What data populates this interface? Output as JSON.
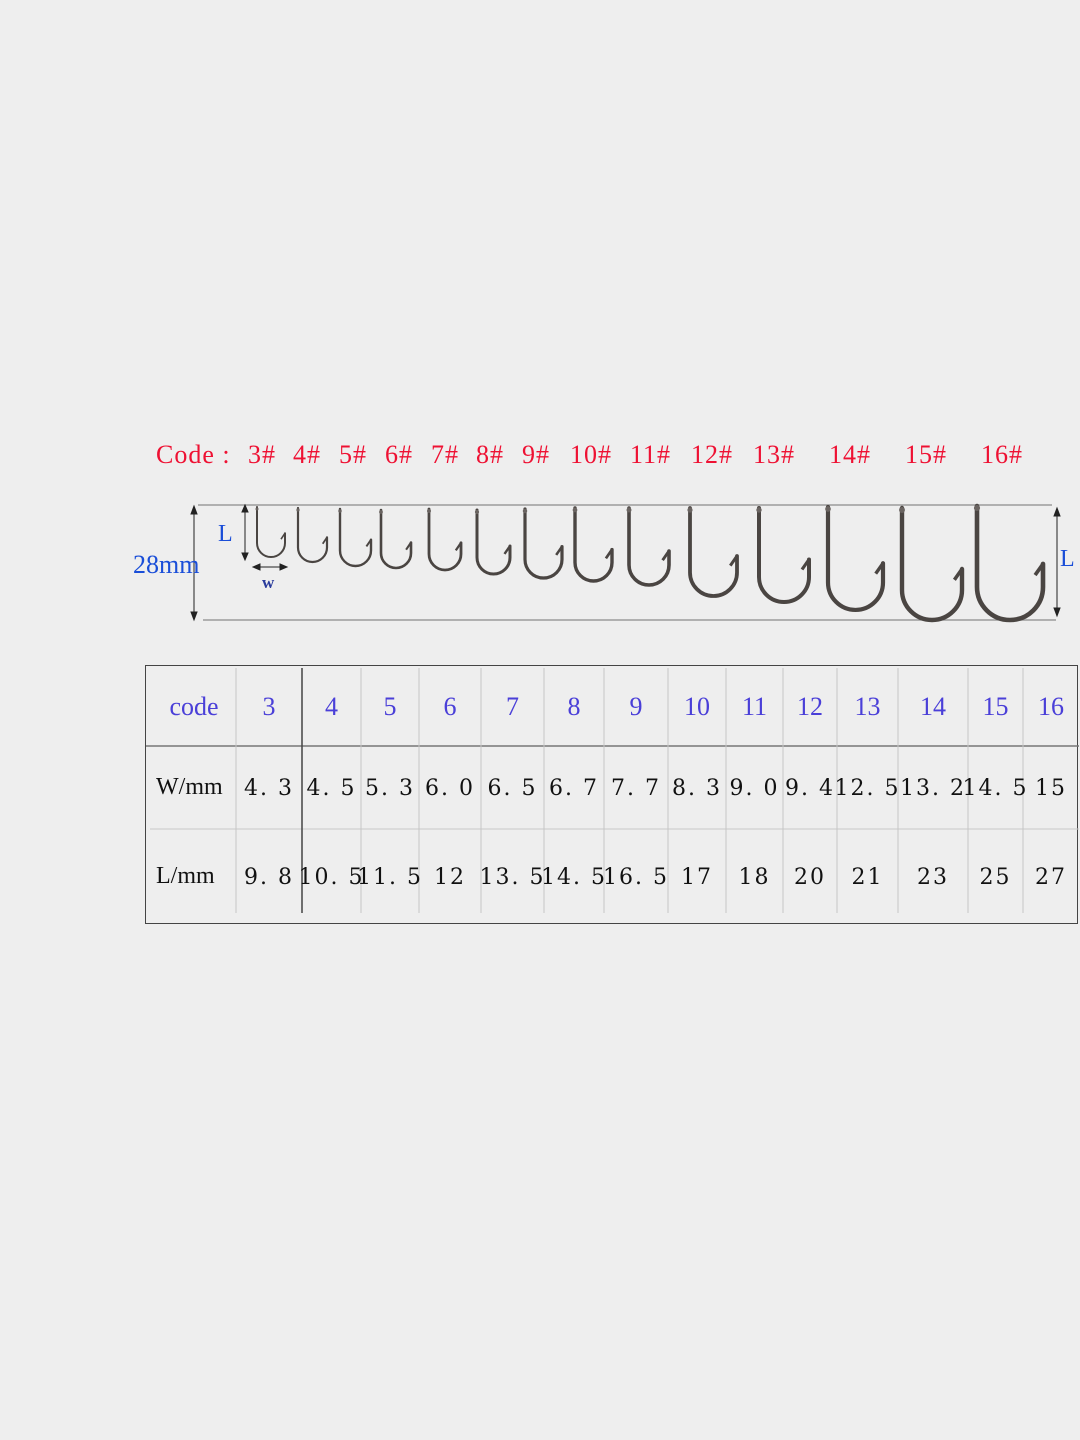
{
  "code_row": {
    "label": "Code :",
    "items": [
      "3#",
      "4#",
      "5#",
      "6#",
      "7#",
      "8#",
      "9#",
      "10#",
      "11#",
      "12#",
      "13#",
      "14#",
      "15#",
      "16#"
    ]
  },
  "figure": {
    "height_label": "28mm",
    "length_label_left": "L",
    "length_label_right": "L",
    "width_label": "w",
    "hook_icon": "fishhook-icon",
    "label_color": "#ee1133",
    "dimension_color": "#1a4ed8"
  },
  "table": {
    "header_label": "code",
    "codes": [
      "3",
      "4",
      "5",
      "6",
      "7",
      "8",
      "9",
      "10",
      "11",
      "12",
      "13",
      "14",
      "15",
      "16"
    ],
    "rows": [
      {
        "label": "W/mm",
        "values": [
          "4. 3",
          "4. 5",
          "5. 3",
          "6. 0",
          "6. 5",
          "6. 7",
          "7. 7",
          "8. 3",
          "9. 0",
          "9. 4",
          "12. 5",
          "13. 2",
          "14. 5",
          "15"
        ]
      },
      {
        "label": "L/mm",
        "values": [
          "9. 8",
          "10. 5",
          "11. 5",
          "12",
          "13. 5",
          "14. 5",
          "16. 5",
          "17",
          "18",
          "20",
          "21",
          "23",
          "25",
          "27"
        ]
      }
    ],
    "header_color": "#4a3fd8"
  }
}
